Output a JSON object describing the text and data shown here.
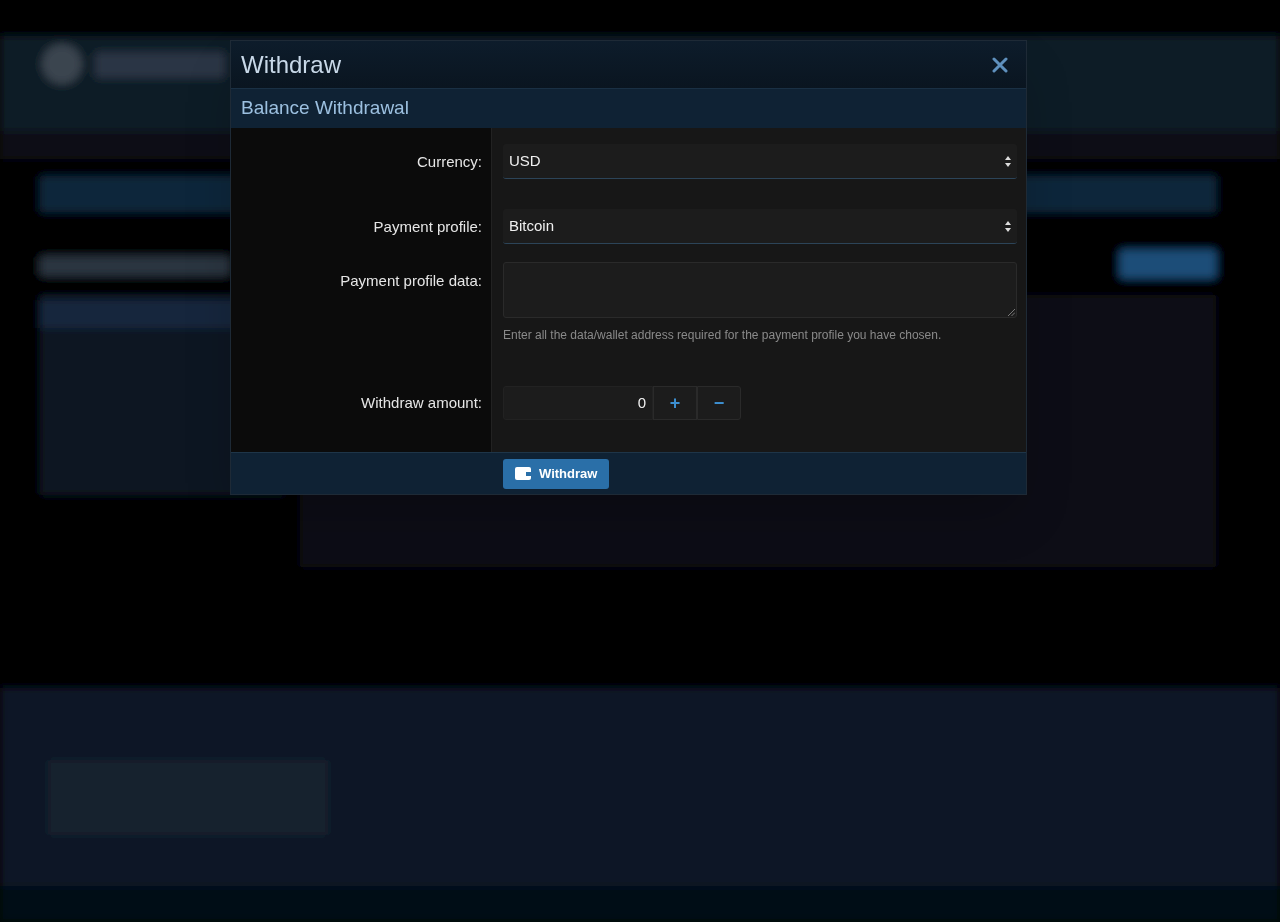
{
  "dialog": {
    "title": "Withdraw",
    "section_title": "Balance Withdrawal",
    "fields": [
      {
        "kind": "select",
        "label": "Currency:",
        "value": "USD"
      },
      {
        "kind": "select",
        "label": "Payment profile:",
        "value": "Bitcoin"
      },
      {
        "kind": "textarea",
        "label": "Payment profile data:",
        "hint": "Enter all the data/wallet address required for the payment profile you have chosen."
      },
      {
        "kind": "number",
        "label": "Withdraw amount:",
        "value": "0",
        "increment": "+",
        "decrement": "−"
      }
    ],
    "submit_button": "Withdraw"
  }
}
